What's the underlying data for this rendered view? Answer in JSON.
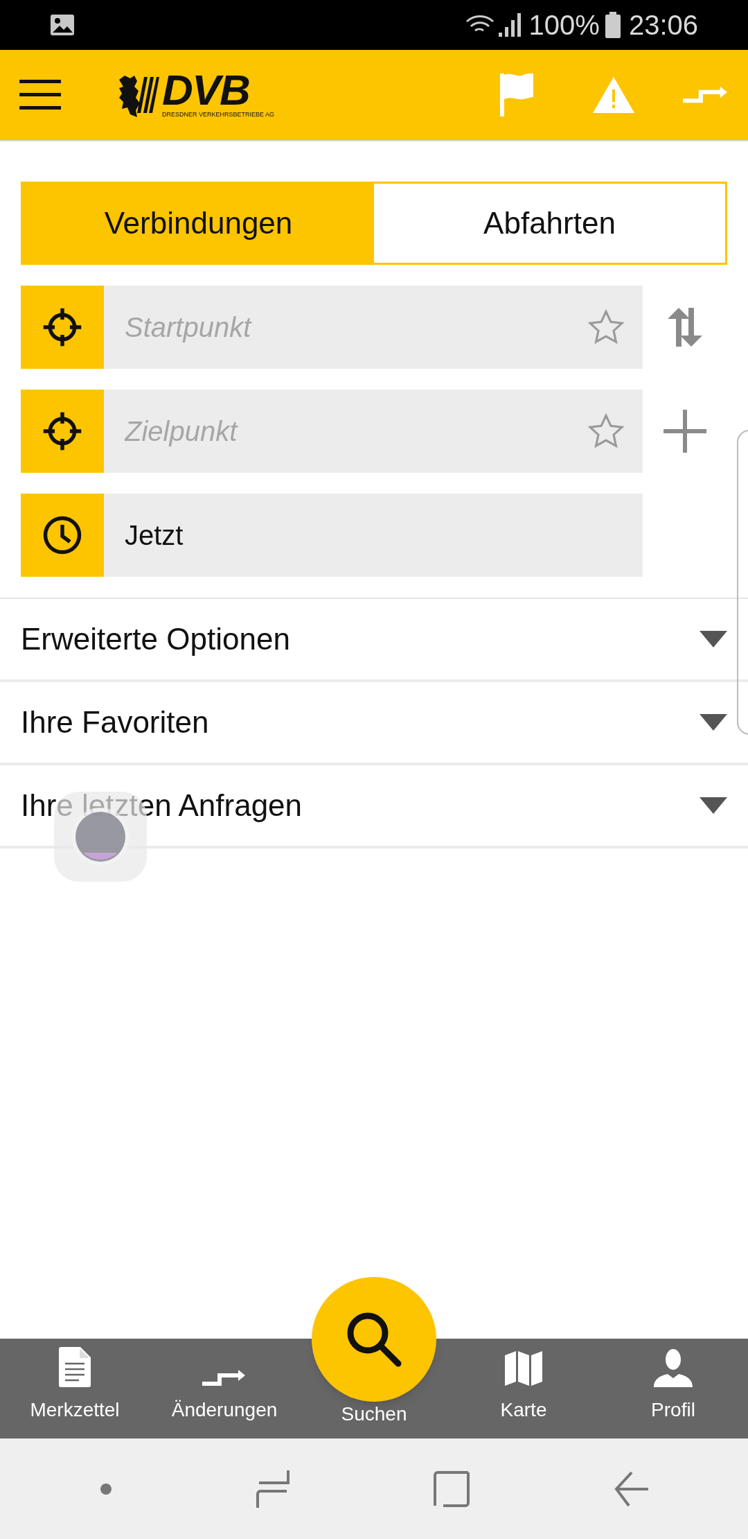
{
  "status_bar": {
    "battery": "100%",
    "time": "23:06"
  },
  "header": {
    "logo_text": "DVB",
    "logo_subtitle": "DRESDNER VERKEHRSBETRIEBE AG"
  },
  "tabs": [
    {
      "label": "Verbindungen",
      "selected": true
    },
    {
      "label": "Abfahrten",
      "selected": false
    }
  ],
  "fields": [
    {
      "kind": "location",
      "placeholder": "Startpunkt",
      "side": {
        "kind": "swap"
      }
    },
    {
      "kind": "location",
      "placeholder": "Zielpunkt",
      "side": {
        "kind": "add"
      }
    },
    {
      "kind": "time",
      "value": "Jetzt"
    }
  ],
  "sections": [
    {
      "title": "Erweiterte Optionen",
      "expanded": false
    },
    {
      "title": "Ihre Favoriten",
      "expanded": false
    },
    {
      "title": "Ihre letzten Anfragen",
      "expanded": false
    }
  ],
  "bottom_nav": [
    {
      "kind": "notes",
      "label": "Merkzettel"
    },
    {
      "kind": "changes",
      "label": "Änderungen"
    },
    {
      "kind": "search",
      "label": "Suchen"
    },
    {
      "kind": "map",
      "label": "Karte"
    },
    {
      "kind": "profile",
      "label": "Profil"
    }
  ]
}
